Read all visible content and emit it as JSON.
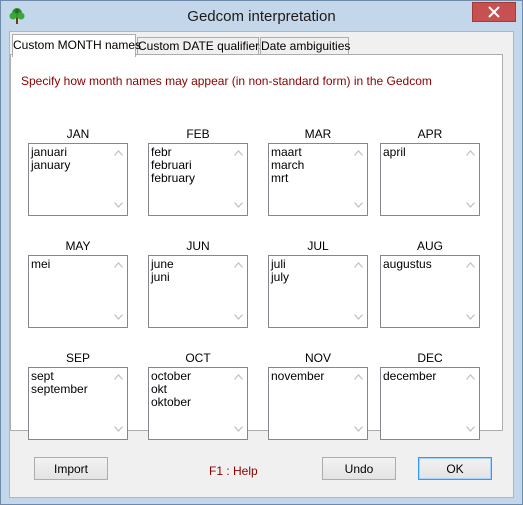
{
  "window": {
    "title": "Gedcom interpretation"
  },
  "tabs": [
    {
      "label": "Custom MONTH names",
      "active": true
    },
    {
      "label": "Custom DATE qualifiers",
      "active": false
    },
    {
      "label": "Date ambiguities",
      "active": false
    }
  ],
  "instruction": "Specify how month names may appear (in non-standard form) in the Gedcom",
  "months": [
    {
      "label": "JAN",
      "values": [
        "januari",
        "january"
      ]
    },
    {
      "label": "FEB",
      "values": [
        "febr",
        "februari",
        "february"
      ]
    },
    {
      "label": "MAR",
      "values": [
        "maart",
        "march",
        "mrt"
      ]
    },
    {
      "label": "APR",
      "values": [
        "april"
      ]
    },
    {
      "label": "MAY",
      "values": [
        "mei"
      ]
    },
    {
      "label": "JUN",
      "values": [
        "june",
        "juni"
      ]
    },
    {
      "label": "JUL",
      "values": [
        "juli",
        "july"
      ]
    },
    {
      "label": "AUG",
      "values": [
        "augustus"
      ]
    },
    {
      "label": "SEP",
      "values": [
        "sept",
        "september"
      ]
    },
    {
      "label": "OCT",
      "values": [
        "october",
        "okt",
        "oktober"
      ]
    },
    {
      "label": "NOV",
      "values": [
        "november"
      ]
    },
    {
      "label": "DEC",
      "values": [
        "december"
      ]
    }
  ],
  "footer": {
    "import_label": "Import",
    "help_text": "F1 : Help",
    "undo_label": "Undo",
    "ok_label": "OK"
  },
  "icons": {
    "app": "tree-icon",
    "close": "close-icon",
    "scroll_up": "scroll-up-arrow-icon",
    "scroll_down": "scroll-down-arrow-icon"
  },
  "colors": {
    "instruction_text": "#8b0000",
    "close_button": "#c75050",
    "frame": "#c3d6ea"
  }
}
